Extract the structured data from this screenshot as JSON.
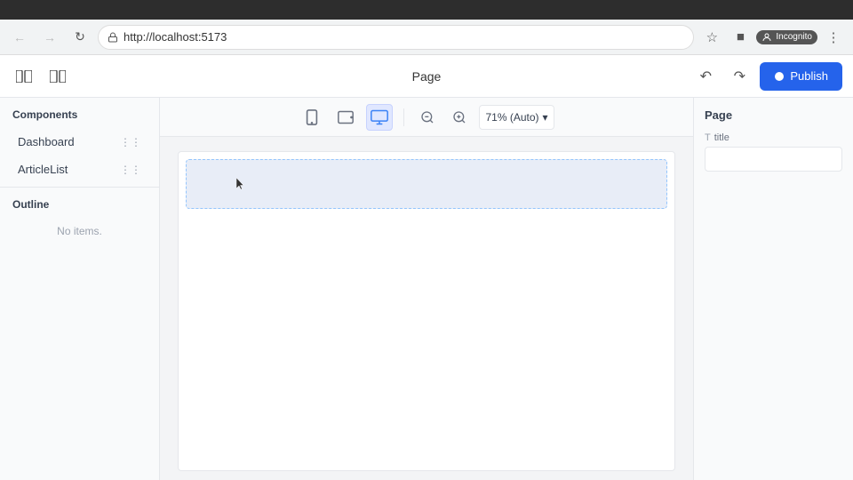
{
  "browser": {
    "url": "http://localhost:5173",
    "incognito_label": "Incognito",
    "back_title": "Back",
    "forward_title": "Forward",
    "refresh_title": "Refresh"
  },
  "header": {
    "title": "Page",
    "undo_label": "Undo",
    "redo_label": "Redo",
    "publish_label": "Publish",
    "left_panel_toggle_title": "Toggle left panel",
    "right_panel_toggle_title": "Toggle right panel"
  },
  "left_sidebar": {
    "components_title": "Components",
    "components": [
      {
        "label": "Dashboard"
      },
      {
        "label": "ArticleList"
      }
    ],
    "outline_title": "Outline",
    "outline_empty": "No items."
  },
  "canvas_toolbar": {
    "device_mobile_title": "Mobile",
    "device_tablet_title": "Tablet",
    "device_desktop_title": "Desktop",
    "zoom_out_title": "Zoom out",
    "zoom_in_title": "Zoom in",
    "zoom_value": "71% (Auto)",
    "zoom_chevron": "▾"
  },
  "right_sidebar": {
    "title": "Page",
    "properties": [
      {
        "label": "title",
        "icon": "T",
        "placeholder": "",
        "value": ""
      }
    ]
  }
}
